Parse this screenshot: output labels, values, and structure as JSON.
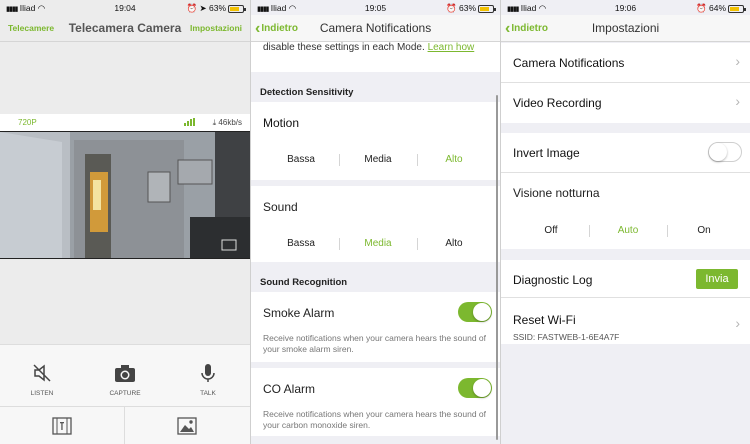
{
  "status": [
    {
      "carrier": "Iliad",
      "time": "19:04",
      "battery": "63%"
    },
    {
      "carrier": "Iliad",
      "time": "19:05",
      "battery": "63%"
    },
    {
      "carrier": "Iliad",
      "time": "19:06",
      "battery": "64%"
    }
  ],
  "camera": {
    "nav_left": "Telecamere",
    "title": "Telecamera Camera",
    "nav_right": "Impostazioni",
    "resolution": "720P",
    "bitrate": "46kb/s",
    "controls": [
      {
        "label": "LISTEN",
        "icon": "speaker-muted-icon"
      },
      {
        "label": "CAPTURE",
        "icon": "camera-icon"
      },
      {
        "label": "TALK",
        "icon": "microphone-icon"
      }
    ],
    "tabs": [
      {
        "icon": "film-icon"
      },
      {
        "icon": "image-icon"
      }
    ]
  },
  "notifications": {
    "back": "Indietro",
    "title": "Camera Notifications",
    "intro_text": "disable these settings in each Mode.",
    "intro_link": "Learn how",
    "detection_header": "Detection Sensitivity",
    "motion": {
      "label": "Motion",
      "options": [
        "Bassa",
        "Media",
        "Alto"
      ],
      "selected": "Alto"
    },
    "sound": {
      "label": "Sound",
      "options": [
        "Bassa",
        "Media",
        "Alto"
      ],
      "selected": "Media"
    },
    "recognition_header": "Sound Recognition",
    "smoke": {
      "label": "Smoke Alarm",
      "enabled": true,
      "description": "Receive notifications when your camera hears the sound of your smoke alarm siren."
    },
    "co": {
      "label": "CO Alarm",
      "enabled": true,
      "description": "Receive notifications when your camera hears the sound of your carbon monoxide siren."
    }
  },
  "settings": {
    "back": "Indietro",
    "title": "Impostazioni",
    "camera_notifications": "Camera Notifications",
    "video_recording": "Video Recording",
    "invert_image": {
      "label": "Invert Image",
      "enabled": false
    },
    "night_vision": {
      "label": "Visione notturna",
      "options": [
        "Off",
        "Auto",
        "On"
      ],
      "selected": "Auto"
    },
    "diagnostic_log": "Diagnostic Log",
    "send_button": "Invia",
    "reset_wifi": "Reset Wi-Fi",
    "ssid": "SSID: FASTWEB-1-6E4A7F"
  },
  "colors": {
    "accent": "#7cb82f",
    "background": "#efeff4"
  }
}
